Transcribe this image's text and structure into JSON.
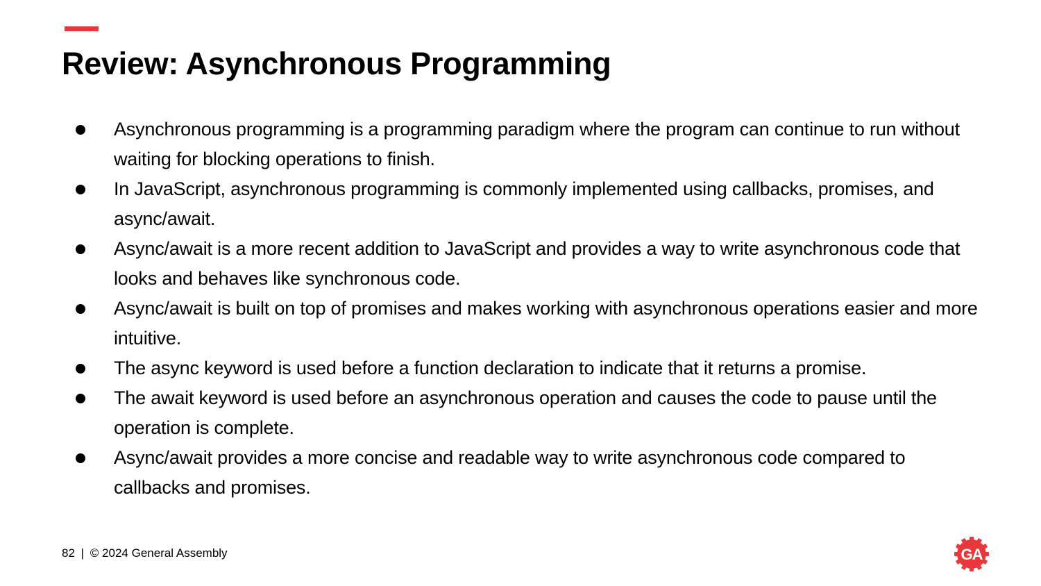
{
  "slide": {
    "title": "Review: Asynchronous Programming",
    "bullets": [
      "Asynchronous programming is a programming paradigm where the program can continue to run without waiting for blocking operations to finish.",
      "In JavaScript, asynchronous programming is commonly implemented using callbacks, promises, and async/await.",
      "Async/await is a more recent addition to JavaScript and provides a way to write asynchronous code that looks and behaves like synchronous code.",
      "Async/await is built on top of promises and makes working with asynchronous operations easier and more intuitive.",
      "The async keyword is used before a function declaration to indicate that it returns a promise.",
      "The await keyword is used before an asynchronous operation and causes the code to pause until the operation is complete.",
      "Async/await provides a more concise and readable way to write asynchronous code compared to callbacks and promises."
    ]
  },
  "footer": {
    "page_number": "82",
    "separator": "|",
    "copyright": "© 2024 General Assembly"
  },
  "logo": {
    "text": "GA",
    "icon": "general-assembly-logo-icon"
  },
  "colors": {
    "accent": "#e8383b",
    "text": "#000000",
    "background": "#ffffff"
  }
}
